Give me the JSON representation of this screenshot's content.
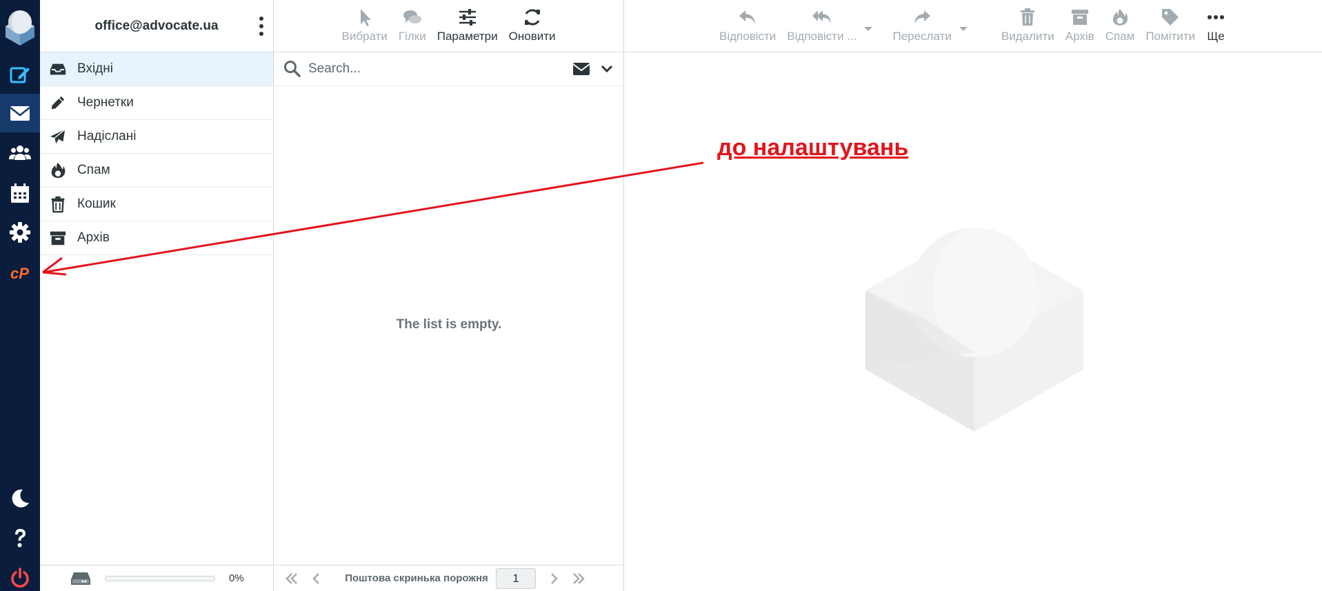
{
  "account": {
    "email": "office@advocate.ua"
  },
  "folders": [
    {
      "label": "Вхідні",
      "icon": "inbox-icon",
      "selected": true
    },
    {
      "label": "Чернетки",
      "icon": "pencil-icon",
      "selected": false
    },
    {
      "label": "Надіслані",
      "icon": "paper-plane-icon",
      "selected": false
    },
    {
      "label": "Спам",
      "icon": "fire-icon",
      "selected": false
    },
    {
      "label": "Кошик",
      "icon": "trash-icon",
      "selected": false
    },
    {
      "label": "Архів",
      "icon": "archive-icon",
      "selected": false
    }
  ],
  "quota": {
    "text": "0%",
    "percent": 0
  },
  "list_toolbar": {
    "select": "Вибрати",
    "threads": "Гілки",
    "options": "Параметри",
    "refresh": "Оновити"
  },
  "search": {
    "placeholder": "Search..."
  },
  "list": {
    "empty_text": "The list is empty.",
    "status": "Поштова скринька порожня",
    "page": "1"
  },
  "message_toolbar": {
    "reply": "Відповісти",
    "reply_all": "Відповісти ...",
    "forward": "Переслати",
    "delete": "Видалити",
    "archive": "Архів",
    "spam": "Спам",
    "mark": "Помітити",
    "more": "Ще"
  },
  "annotation": {
    "text": "до налаштувань",
    "color": "#e3141c"
  },
  "colors": {
    "rail": "#0b1d3c",
    "accent": "#37beff",
    "cpanel": "#ff6c2c",
    "logout": "#ff4a4a"
  }
}
